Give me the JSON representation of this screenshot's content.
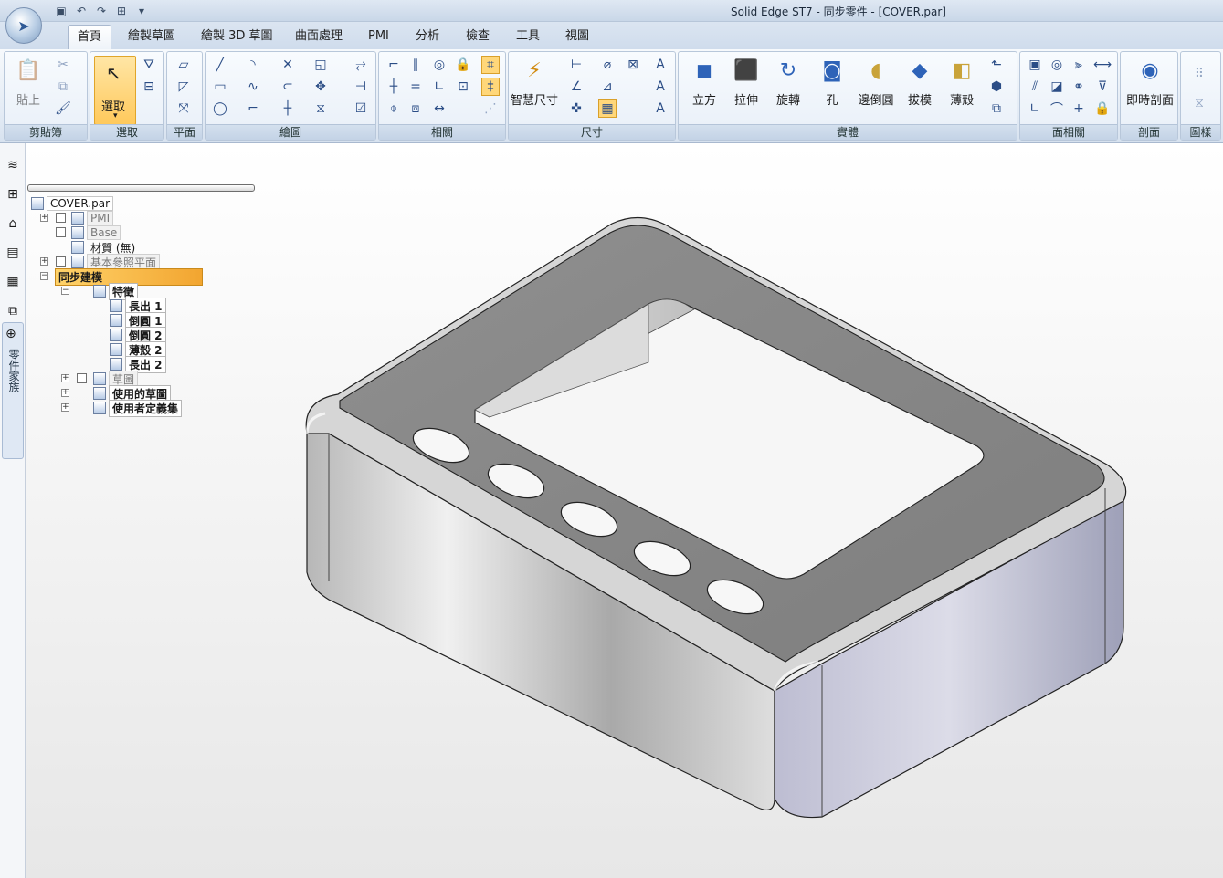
{
  "window": {
    "title": "Solid Edge ST7 - 同步零件 - [COVER.par]"
  },
  "tabs": [
    {
      "label": "首頁",
      "active": true
    },
    {
      "label": "繪製草圖"
    },
    {
      "label": "繪製 3D 草圖"
    },
    {
      "label": "曲面處理"
    },
    {
      "label": "PMI"
    },
    {
      "label": "分析"
    },
    {
      "label": "檢查"
    },
    {
      "label": "工具"
    },
    {
      "label": "視圖"
    }
  ],
  "ribbon": {
    "clipboard": {
      "label": "剪貼簿",
      "paste": "貼上"
    },
    "select": {
      "label": "選取",
      "button": "選取"
    },
    "plane": {
      "label": "平面"
    },
    "draw": {
      "label": "繪圖"
    },
    "relate": {
      "label": "相關"
    },
    "dimension": {
      "label": "尺寸",
      "smart": "智慧尺寸"
    },
    "solids": {
      "label": "實體",
      "buttons": [
        "立方",
        "拉伸",
        "旋轉",
        "孔",
        "邊倒圓",
        "拔模",
        "薄殼"
      ]
    },
    "face": {
      "label": "面相關"
    },
    "section": {
      "label": "剖面",
      "live": "即時剖面"
    },
    "pattern": {
      "label": "圖樣"
    }
  },
  "lefttools": {
    "vertical_tab": "零件家族"
  },
  "tree": {
    "root": "COVER.par",
    "pmi": "PMI",
    "base": "Base",
    "material": "材質 (無)",
    "ref_planes": "基本參照平面",
    "sync": "同步建模",
    "features": "特徵",
    "items": [
      "長出 1",
      "倒圓 1",
      "倒圓 2",
      "薄殼 2",
      "長出 2"
    ],
    "sketch": "草圖",
    "used_sketch": "使用的草圖",
    "user_sets": "使用者定義集"
  },
  "colors": {
    "accent": "#f2a530",
    "ribbon": "#dbe5f1"
  }
}
